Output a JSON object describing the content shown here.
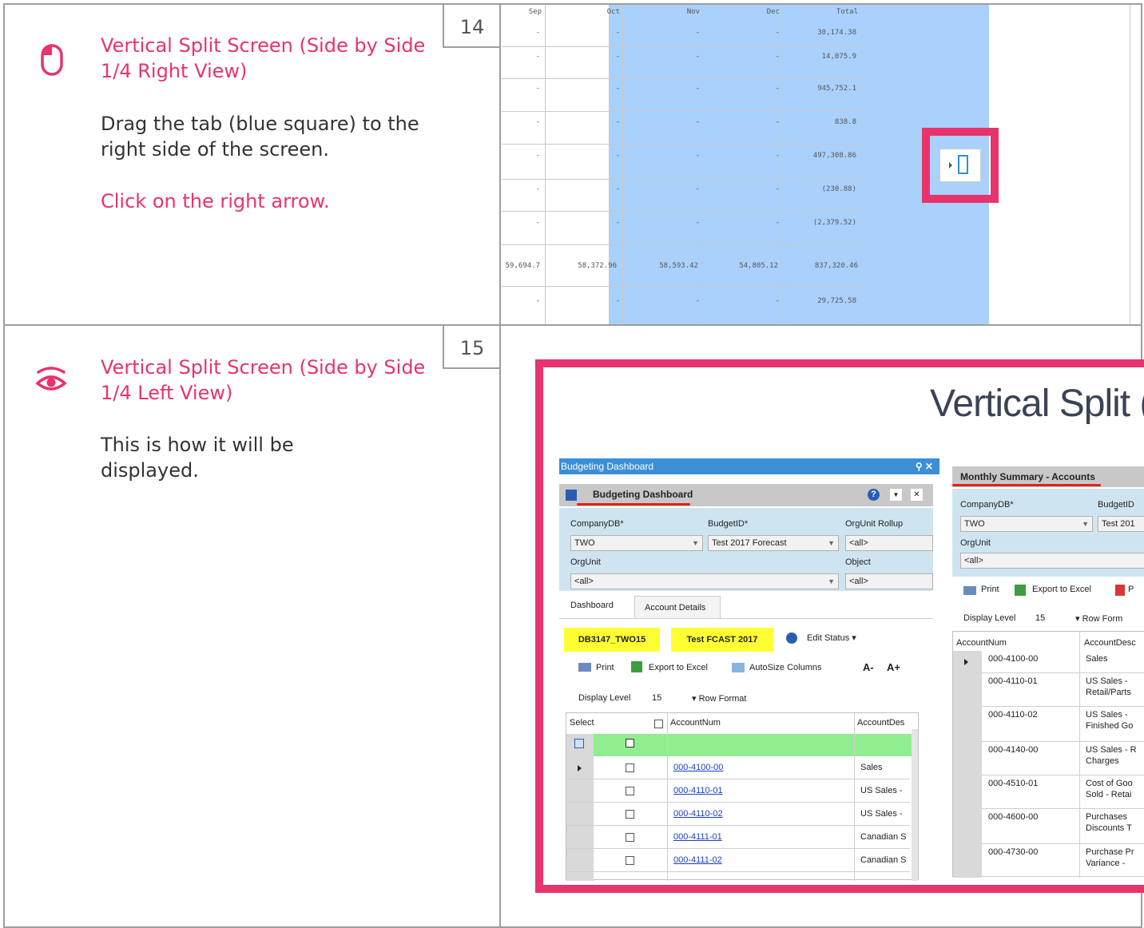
{
  "steps": [
    {
      "number": "14",
      "title": "Vertical Split Screen (Side by Side 1/4 Right View)",
      "body": "Drag the tab (blue square) to the right side of the screen.",
      "action": "Click on the right arrow.",
      "icon": "mouse-icon"
    },
    {
      "number": "15",
      "title": "Vertical Split Screen (Side by Side 1/4 Left View)",
      "body": "This is how it will be displayed.",
      "icon": "eye-icon"
    }
  ],
  "colors": {
    "accent": "#e8336d",
    "highlight_blue": "#a9d1fb",
    "border": "#9e9e9e"
  },
  "grid14": {
    "headers": [
      "Sep",
      "Oct",
      "Nov",
      "Dec",
      "Total"
    ],
    "totals": [
      "30,174.38",
      "14,075.9",
      "945,752.1",
      "838.8",
      "497,308.86",
      "(230.88)",
      "(2,379.52)",
      "837,320.46",
      "29,725.58"
    ],
    "dash": "-",
    "sum_row": [
      "59,694.7",
      "58,372.96",
      "58,593.42",
      "54,805.12",
      "837,320.46"
    ]
  },
  "dashboard": {
    "big_title": "Vertical Split (",
    "left_panel": {
      "window_title": "Budgeting Dashboard",
      "pin_close": "⚲ ✕",
      "header": "Budgeting Dashboard",
      "company_label": "CompanyDB*",
      "company_value": "TWO",
      "budget_label": "BudgetID*",
      "budget_value": "Test 2017 Forecast",
      "rollup_label": "OrgUnit Rollup",
      "rollup_value": "<all>",
      "orgunit_label": "OrgUnit",
      "orgunit_value": "<all>",
      "object_label": "Object",
      "object_value": "<all>",
      "tabs": [
        "Dashboard",
        "Account Details"
      ],
      "tag1": "DB3147_TWO15",
      "tag2": "Test FCAST 2017",
      "edit_status": "Edit Status",
      "print": "Print",
      "export": "Export to Excel",
      "autosize": "AutoSize Columns",
      "font_down": "A-",
      "font_up": "A+",
      "display_level_label": "Display Level",
      "display_level_value": "15",
      "row_format": "Row Format",
      "col_select": "Select",
      "col_account": "AccountNum",
      "col_desc": "AccountDes",
      "rows": [
        {
          "account": "000-4100-00",
          "desc": "Sales"
        },
        {
          "account": "000-4110-01",
          "desc": "US Sales -"
        },
        {
          "account": "000-4110-02",
          "desc": "US Sales -"
        },
        {
          "account": "000-4111-01",
          "desc": "Canadian S"
        },
        {
          "account": "000-4111-02",
          "desc": "Canadian S"
        }
      ]
    },
    "right_panel": {
      "header": "Monthly Summary - Accounts",
      "company_label": "CompanyDB*",
      "company_value": "TWO",
      "budget_label": "BudgetID",
      "budget_value": "Test 201",
      "orgunit_label": "OrgUnit",
      "orgunit_value": "<all>",
      "print": "Print",
      "export": "Export to Excel",
      "p_label": "P",
      "display_level_label": "Display Level",
      "display_level_value": "15",
      "row_format": "Row Form",
      "col_account": "AccountNum",
      "col_desc": "AccountDesc",
      "rows": [
        {
          "account": "000-4100-00",
          "desc1": "Sales",
          "desc2": ""
        },
        {
          "account": "000-4110-01",
          "desc1": "US Sales -",
          "desc2": "Retail/Parts"
        },
        {
          "account": "000-4110-02",
          "desc1": "US Sales -",
          "desc2": "Finished Go"
        },
        {
          "account": "000-4140-00",
          "desc1": "US Sales - R",
          "desc2": "Charges"
        },
        {
          "account": "000-4510-01",
          "desc1": "Cost of Goo",
          "desc2": "Sold - Retai"
        },
        {
          "account": "000-4600-00",
          "desc1": "Purchases",
          "desc2": "Discounts T"
        },
        {
          "account": "000-4730-00",
          "desc1": "Purchase Pr",
          "desc2": "Variance -"
        }
      ]
    }
  }
}
